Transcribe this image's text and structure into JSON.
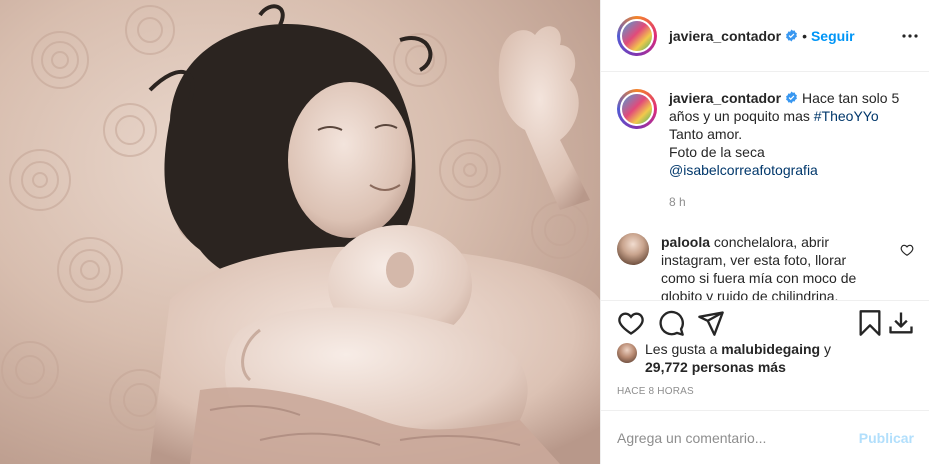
{
  "post": {
    "image_alt": "Black and white photo of a woman lying on a bed with a newborn on her chest",
    "image_icon": "photo",
    "header": {
      "username": "javiera_contador",
      "verified_icon": "verified-badge-icon",
      "separator": "•",
      "follow_label": "Seguir",
      "more_icon": "more-options-icon"
    },
    "caption": {
      "username": "javiera_contador",
      "text_1": " Hace tan solo 5 años y un poquito mas ",
      "hashtag": "#TheoYYo",
      "text_2": "Tanto amor.",
      "text_3": "Foto de la seca ",
      "mention": "@isabelcorreafotografia",
      "time": "8 h"
    },
    "comments": [
      {
        "username": "paloola",
        "text": " conchelalora, abrir instagram, ver esta foto, llorar como si fuera mía con moco de globito y ruido de chilindrina,"
      }
    ],
    "actions": {
      "like_icon": "heart-icon",
      "comment_icon": "comment-icon",
      "share_icon": "share-icon",
      "save_icon": "bookmark-icon",
      "download_icon": "download-icon"
    },
    "likes": {
      "prefix": "Les gusta a ",
      "user": "malubidegaing",
      "mid": " y",
      "count": "29,772 personas más"
    },
    "time_ago": "HACE 8 HORAS",
    "add_comment": {
      "placeholder": "Agrega un comentario...",
      "publish_label": "Publicar"
    },
    "colors": {
      "accent": "#0095f6",
      "link": "#00376b",
      "muted": "#8e8e8e",
      "publish_disabled": "#b2dffc"
    }
  }
}
